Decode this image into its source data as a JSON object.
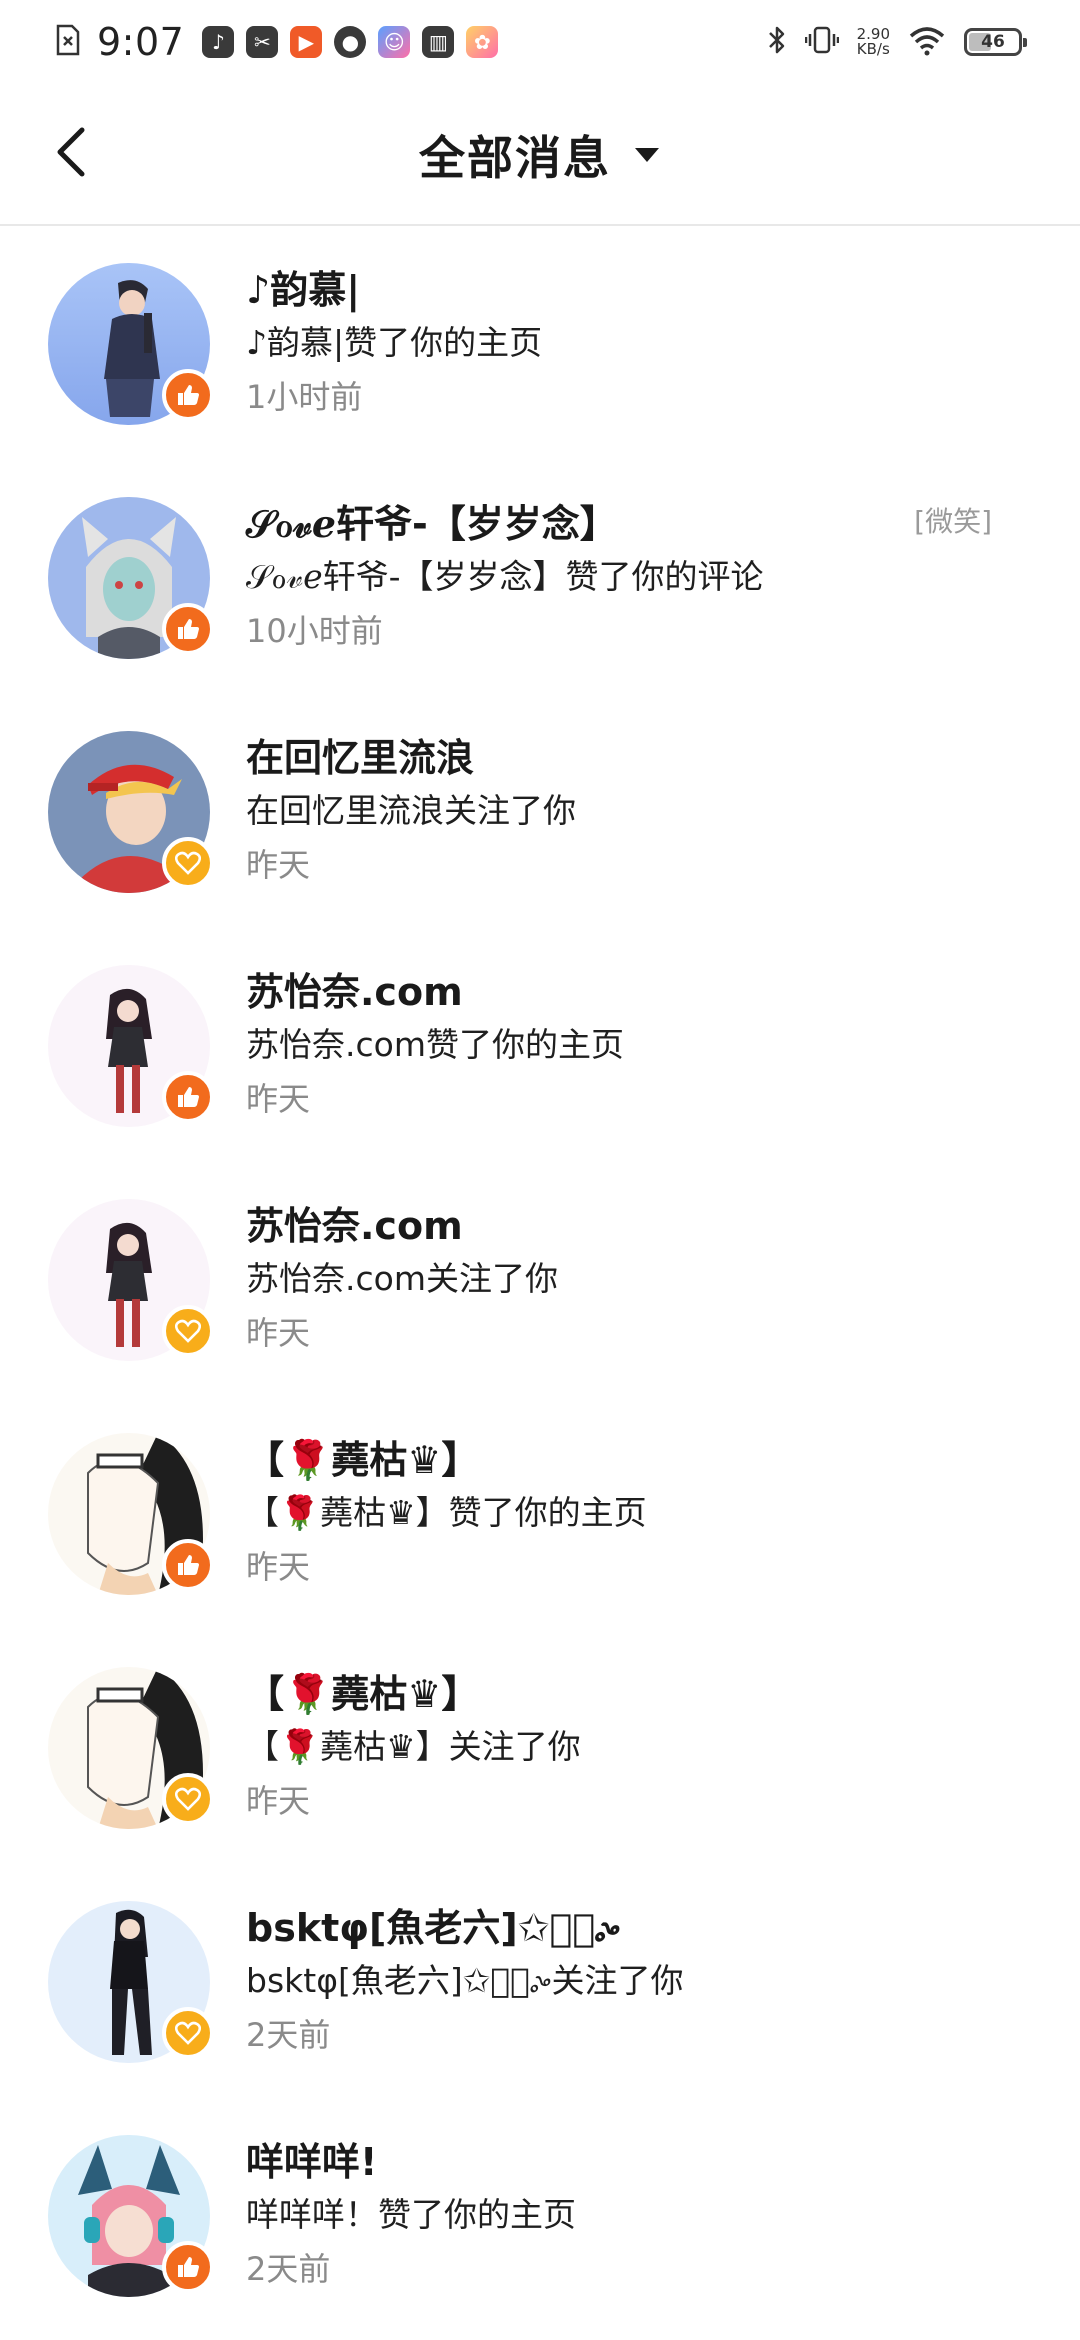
{
  "status_bar": {
    "time": "9:07",
    "net_speed_value": "2.90",
    "net_speed_unit": "KB/s",
    "battery": "46",
    "battery_fraction": 0.46
  },
  "header": {
    "title": "全部消息"
  },
  "messages": [
    {
      "name": "♪韵慕|",
      "text": "♪韵慕|赞了你的主页",
      "time": "1小时前",
      "type": "like",
      "avatar": "avatar-girl-dark-outfit"
    },
    {
      "name": "𝒮ℴ𝓋ℯ轩爷-【岁岁念】",
      "text": "𝒮ℴ𝓋ℯ轩爷-【岁岁念】赞了你的评论",
      "time": "10小时前",
      "type": "like",
      "tag": "[微笑]",
      "avatar": "avatar-white-hair-catgirl"
    },
    {
      "name": "在回忆里流浪",
      "text": "在回忆里流浪关注了你",
      "time": "昨天",
      "type": "follow",
      "avatar": "avatar-red-cap-boy"
    },
    {
      "name": "苏怡奈.com",
      "text": "苏怡奈.com赞了你的主页",
      "time": "昨天",
      "type": "like",
      "avatar": "avatar-chibi-girl"
    },
    {
      "name": "苏怡奈.com",
      "text": "苏怡奈.com关注了你",
      "time": "昨天",
      "type": "follow",
      "avatar": "avatar-chibi-girl"
    },
    {
      "name": "【🌹蕘枯♛】",
      "text": "【🌹蕘枯♛】赞了你的主页",
      "time": "昨天",
      "type": "like",
      "avatar": "avatar-sketch-profile"
    },
    {
      "name": "【🌹蕘枯♛】",
      "text": "【🌹蕘枯♛】关注了你",
      "time": "昨天",
      "type": "follow",
      "avatar": "avatar-sketch-profile"
    },
    {
      "name": "bsktφ[魚老六]✩ᢀ͛ᤱᤴ",
      "text": "bsktφ[魚老六]✩ᢀ͛ᤱᤴ关注了你",
      "time": "2天前",
      "type": "follow",
      "avatar": "avatar-standing-girl"
    },
    {
      "name": "咩咩咩!",
      "text": "咩咩咩！赞了你的主页",
      "time": "2天前",
      "type": "like",
      "avatar": "avatar-pink-hair-headphones"
    }
  ]
}
